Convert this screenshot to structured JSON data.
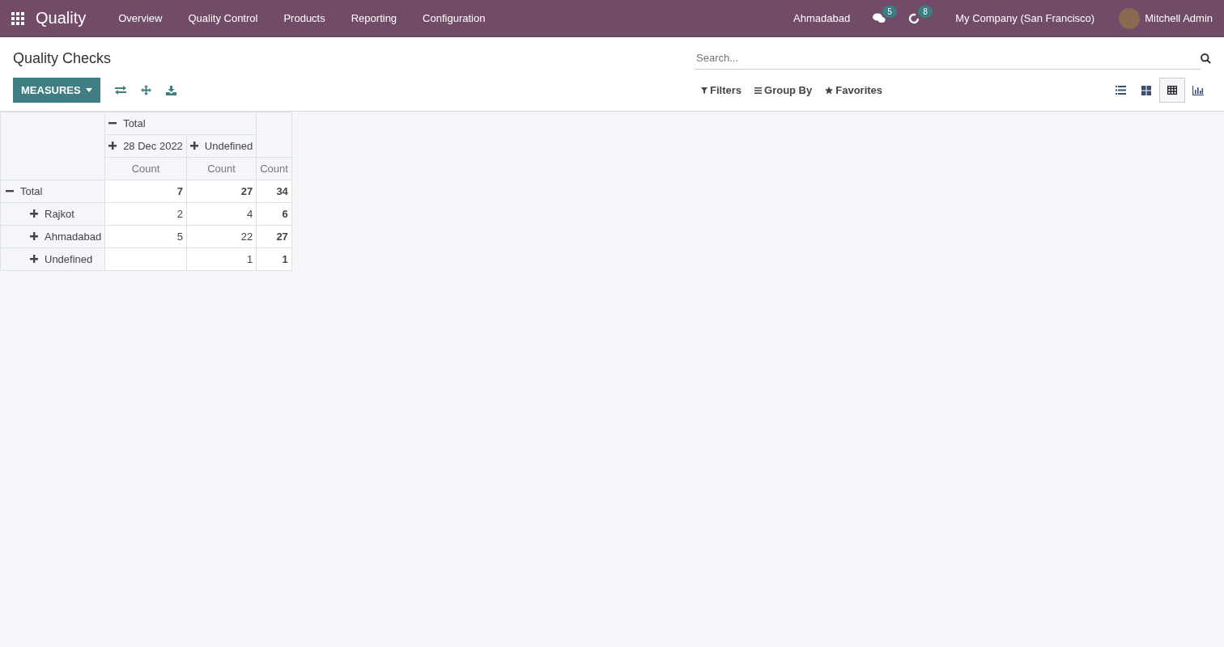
{
  "app": {
    "title": "Quality"
  },
  "nav": [
    "Overview",
    "Quality Control",
    "Products",
    "Reporting",
    "Configuration"
  ],
  "topbar": {
    "branch": "Ahmadabad",
    "messages_badge": "5",
    "activities_badge": "8",
    "company": "My Company (San Francisco)",
    "user": "Mitchell Admin"
  },
  "page": {
    "title": "Quality Checks",
    "measures_button": "MEASURES"
  },
  "search": {
    "placeholder": "Search..."
  },
  "search_options": [
    "Filters",
    "Group By",
    "Favorites"
  ],
  "views": [
    {
      "kind": "list",
      "selected": false
    },
    {
      "kind": "kanban",
      "selected": false
    },
    {
      "kind": "pivot",
      "selected": true
    },
    {
      "kind": "graph",
      "selected": false
    }
  ],
  "pivot": {
    "column_header": {
      "label": "Total",
      "expanded": true,
      "children": [
        {
          "label": "28 Dec 2022",
          "expanded": false
        },
        {
          "label": "Undefined",
          "expanded": false
        }
      ]
    },
    "measures": [
      "Count",
      "Count",
      "Count"
    ],
    "rows": [
      {
        "label": "Total",
        "expanded": true,
        "cells": [
          "7",
          "27",
          "34"
        ],
        "children": [
          {
            "label": "Rajkot",
            "expanded": false,
            "cells": [
              "2",
              "4",
              "6"
            ]
          },
          {
            "label": "Ahmadabad",
            "expanded": false,
            "cells": [
              "5",
              "22",
              "27"
            ]
          },
          {
            "label": "Undefined",
            "expanded": false,
            "cells": [
              null,
              "1",
              "1"
            ]
          }
        ]
      }
    ]
  }
}
